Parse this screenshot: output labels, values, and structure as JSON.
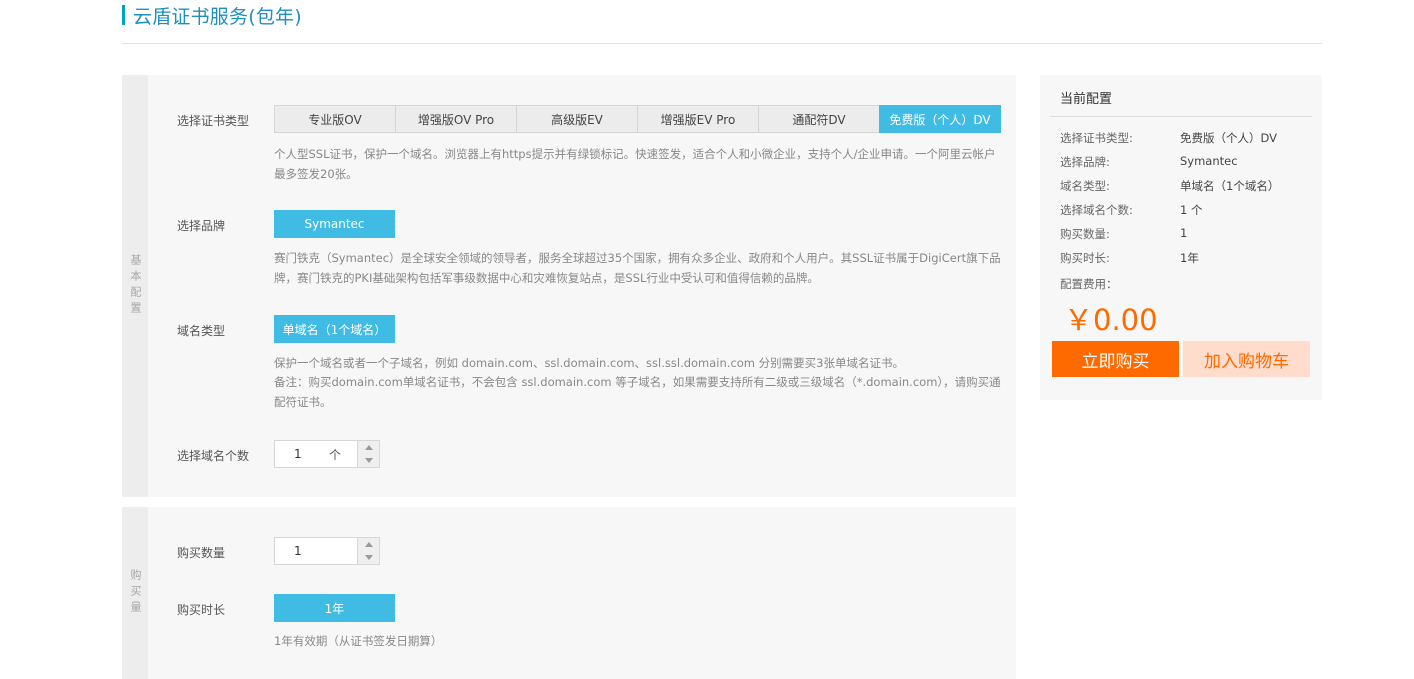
{
  "page": {
    "title": "云盾证书服务(包年)"
  },
  "basic": {
    "side_label": "基本配置",
    "cert_type": {
      "label": "选择证书类型",
      "tabs": [
        "专业版OV",
        "增强版OV Pro",
        "高级版EV",
        "增强版EV Pro",
        "通配符DV",
        "免费版（个人）DV"
      ],
      "active_index": 5,
      "desc": "个人型SSL证书，保护一个域名。浏览器上有https提示并有绿锁标记。快速签发，适合个人和小微企业，支持个人/企业申请。一个阿里云帐户最多签发20张。"
    },
    "brand": {
      "label": "选择品牌",
      "value": "Symantec",
      "desc": "赛门铁克（Symantec）是全球安全领域的领导者，服务全球超过35个国家，拥有众多企业、政府和个人用户。其SSL证书属于DigiCert旗下品牌，赛门铁克的PKI基础架构包括军事级数据中心和灾难恢复站点，是SSL行业中受认可和值得信赖的品牌。"
    },
    "domain_type": {
      "label": "域名类型",
      "value": "单域名（1个域名）",
      "desc_line1": "保护一个域名或者一个子域名，例如 domain.com、ssl.domain.com、ssl.ssl.domain.com 分别需要买3张单域名证书。",
      "desc_line2": "备注：购买domain.com单域名证书，不会包含 ssl.domain.com 等子域名，如果需要支持所有二级或三级域名（*.domain.com），请购买通配符证书。"
    },
    "domain_count": {
      "label": "选择域名个数",
      "value": "1",
      "unit": "个"
    }
  },
  "buy": {
    "side_label": "购买量",
    "quantity": {
      "label": "购买数量",
      "value": "1"
    },
    "duration": {
      "label": "购买时长",
      "value": "1年",
      "desc": "1年有效期（从证书签发日期算）"
    }
  },
  "summary": {
    "title": "当前配置",
    "rows": [
      {
        "k": "选择证书类型:",
        "v": "免费版（个人）DV"
      },
      {
        "k": "选择品牌:",
        "v": "Symantec"
      },
      {
        "k": "域名类型:",
        "v": "单域名（1个域名）"
      },
      {
        "k": "选择域名个数:",
        "v": "1 个"
      },
      {
        "k": "购买数量:",
        "v": "1"
      },
      {
        "k": "购买时长:",
        "v": "1年"
      }
    ],
    "fee_label": "配置费用：",
    "price": "￥0.00",
    "buy_now": "立即购买",
    "add_cart": "加入购物车"
  },
  "colors": {
    "accent": "#40bce4",
    "orange": "#ff6a00",
    "title_blue": "#1f8fbf"
  }
}
